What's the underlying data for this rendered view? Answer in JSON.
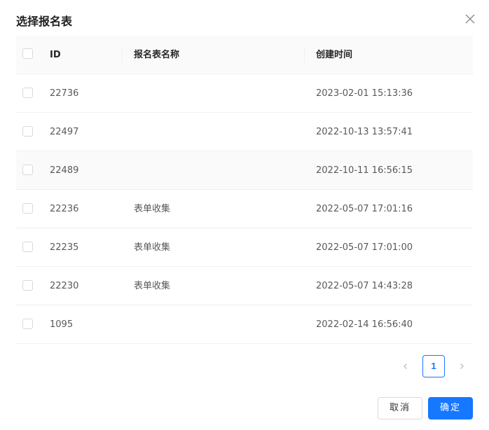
{
  "dialog": {
    "title": "选择报名表",
    "close_icon": "close-icon"
  },
  "table": {
    "columns": [
      "ID",
      "报名表名称",
      "创建时间"
    ],
    "rows": [
      {
        "id": "22736",
        "name": "",
        "created": "2023-02-01 15:13:36"
      },
      {
        "id": "22497",
        "name": "",
        "created": "2022-10-13 13:57:41"
      },
      {
        "id": "22489",
        "name": "",
        "created": "2022-10-11 16:56:15"
      },
      {
        "id": "22236",
        "name": "表单收集",
        "created": "2022-05-07 17:01:16"
      },
      {
        "id": "22235",
        "name": "表单收集",
        "created": "2022-05-07 17:01:00"
      },
      {
        "id": "22230",
        "name": "表单收集",
        "created": "2022-05-07 14:43:28"
      },
      {
        "id": "1095",
        "name": "",
        "created": "2022-02-14 16:56:40"
      }
    ]
  },
  "pagination": {
    "current_page": "1"
  },
  "footer": {
    "cancel_label": "取消",
    "ok_label": "确定"
  },
  "colors": {
    "primary": "#1677ff",
    "header_bg": "#fafafa",
    "border": "#f0f0f0"
  }
}
